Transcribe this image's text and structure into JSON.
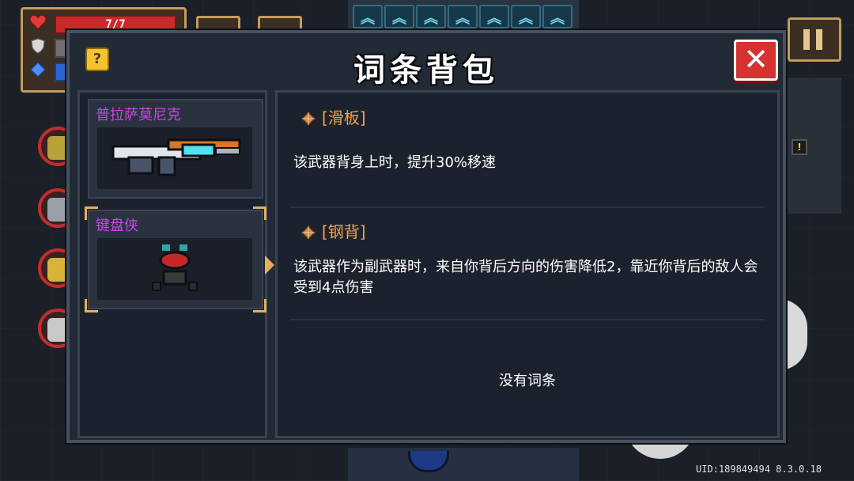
{
  "hud": {
    "hp_text": "7/7"
  },
  "modal": {
    "title": "词条背包",
    "help_label": "?",
    "close_label": "✕"
  },
  "weapons": [
    {
      "name": "普拉萨莫尼克",
      "selected": false
    },
    {
      "name": "键盘侠",
      "selected": true
    }
  ],
  "affixes": [
    {
      "icon": "bronze-gem-icon",
      "title": "[滑板]",
      "description": "该武器背身上时，提升30%移速"
    },
    {
      "icon": "bronze-gem-icon",
      "title": "[钢背]",
      "description": "该武器作为副武器时，来自你背后方向的伤害降低2，靠近你背后的敌人会受到4点伤害"
    }
  ],
  "empty_text": "没有词条",
  "footer": {
    "uid": "UID:189849494 8.3.0.18"
  }
}
